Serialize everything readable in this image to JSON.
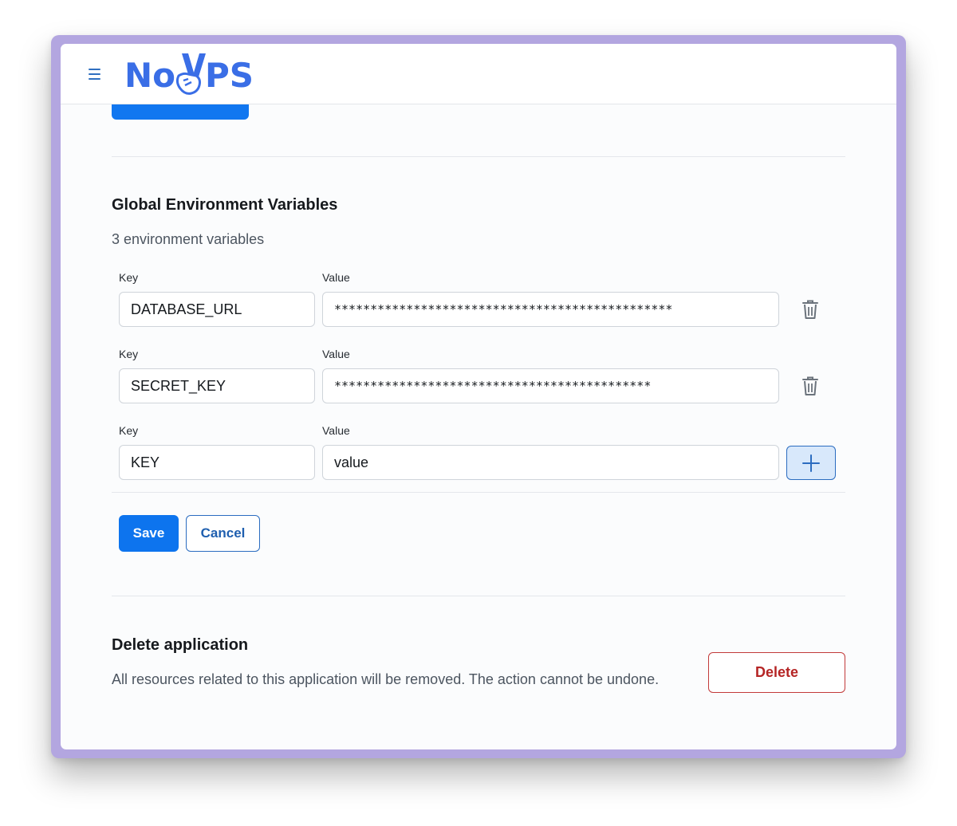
{
  "app": {
    "logo_text": "NoVPS",
    "brand_color": "#3a6ee6"
  },
  "icons": {
    "menu": "hamburger-menu-icon",
    "delete": "trash-icon",
    "add": "plus-icon"
  },
  "env": {
    "title": "Global Environment Variables",
    "count_text": "3 environment variables",
    "rows": [
      {
        "key_label": "Key",
        "value_label": "Value",
        "key": "DATABASE_URL",
        "value": "***********************************************"
      },
      {
        "key_label": "Key",
        "value_label": "Value",
        "key": "SECRET_KEY",
        "value": "********************************************"
      }
    ],
    "new_row": {
      "key_label": "Key",
      "value_label": "Value",
      "key_value": "KEY",
      "value_value": "value"
    },
    "save_label": "Save",
    "cancel_label": "Cancel"
  },
  "danger": {
    "title": "Delete application",
    "description": "All resources related to this application will be removed. The action cannot be undone.",
    "delete_label": "Delete",
    "delete_color": "#b52525"
  }
}
